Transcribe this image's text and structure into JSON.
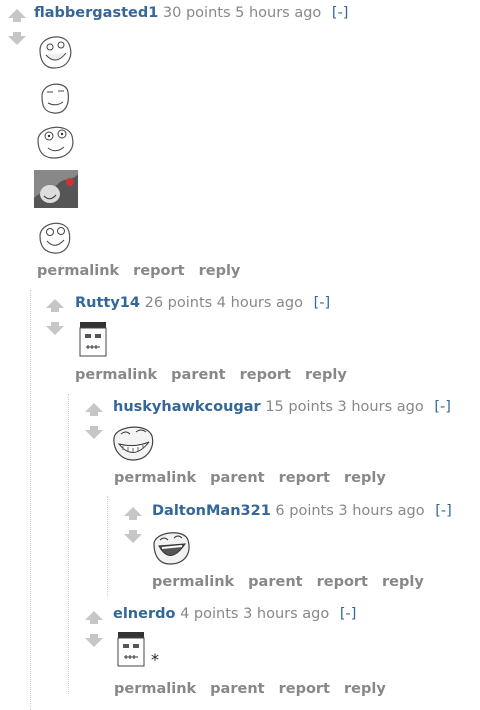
{
  "comments": [
    {
      "author": "flabbergasted1",
      "points": "30 points",
      "time": "5 hours ago",
      "toggle": "[-]",
      "faces": [
        "grin-face",
        "smirk-face",
        "surprised-face",
        "photo-face",
        "smile-face"
      ],
      "links": [
        "permalink",
        "report",
        "reply"
      ]
    },
    {
      "author": "Rutty14",
      "points": "26 points",
      "time": "4 hours ago",
      "toggle": "[-]",
      "faces": [
        "frankenstein-face"
      ],
      "links": [
        "permalink",
        "parent",
        "report",
        "reply"
      ]
    },
    {
      "author": "huskyhawkcougar",
      "points": "15 points",
      "time": "3 hours ago",
      "toggle": "[-]",
      "faces": [
        "troll-face"
      ],
      "links": [
        "permalink",
        "parent",
        "report",
        "reply"
      ]
    },
    {
      "author": "DaltonMan321",
      "points": "6 points",
      "time": "3 hours ago",
      "toggle": "[-]",
      "faces": [
        "laughing-face"
      ],
      "links": [
        "permalink",
        "parent",
        "report",
        "reply"
      ]
    },
    {
      "author": "elnerdo",
      "points": "4 points",
      "time": "3 hours ago",
      "toggle": "[-]",
      "faces": [
        "frankenstein-face"
      ],
      "extra_text": "*",
      "links": [
        "permalink",
        "parent",
        "report",
        "reply"
      ]
    }
  ]
}
